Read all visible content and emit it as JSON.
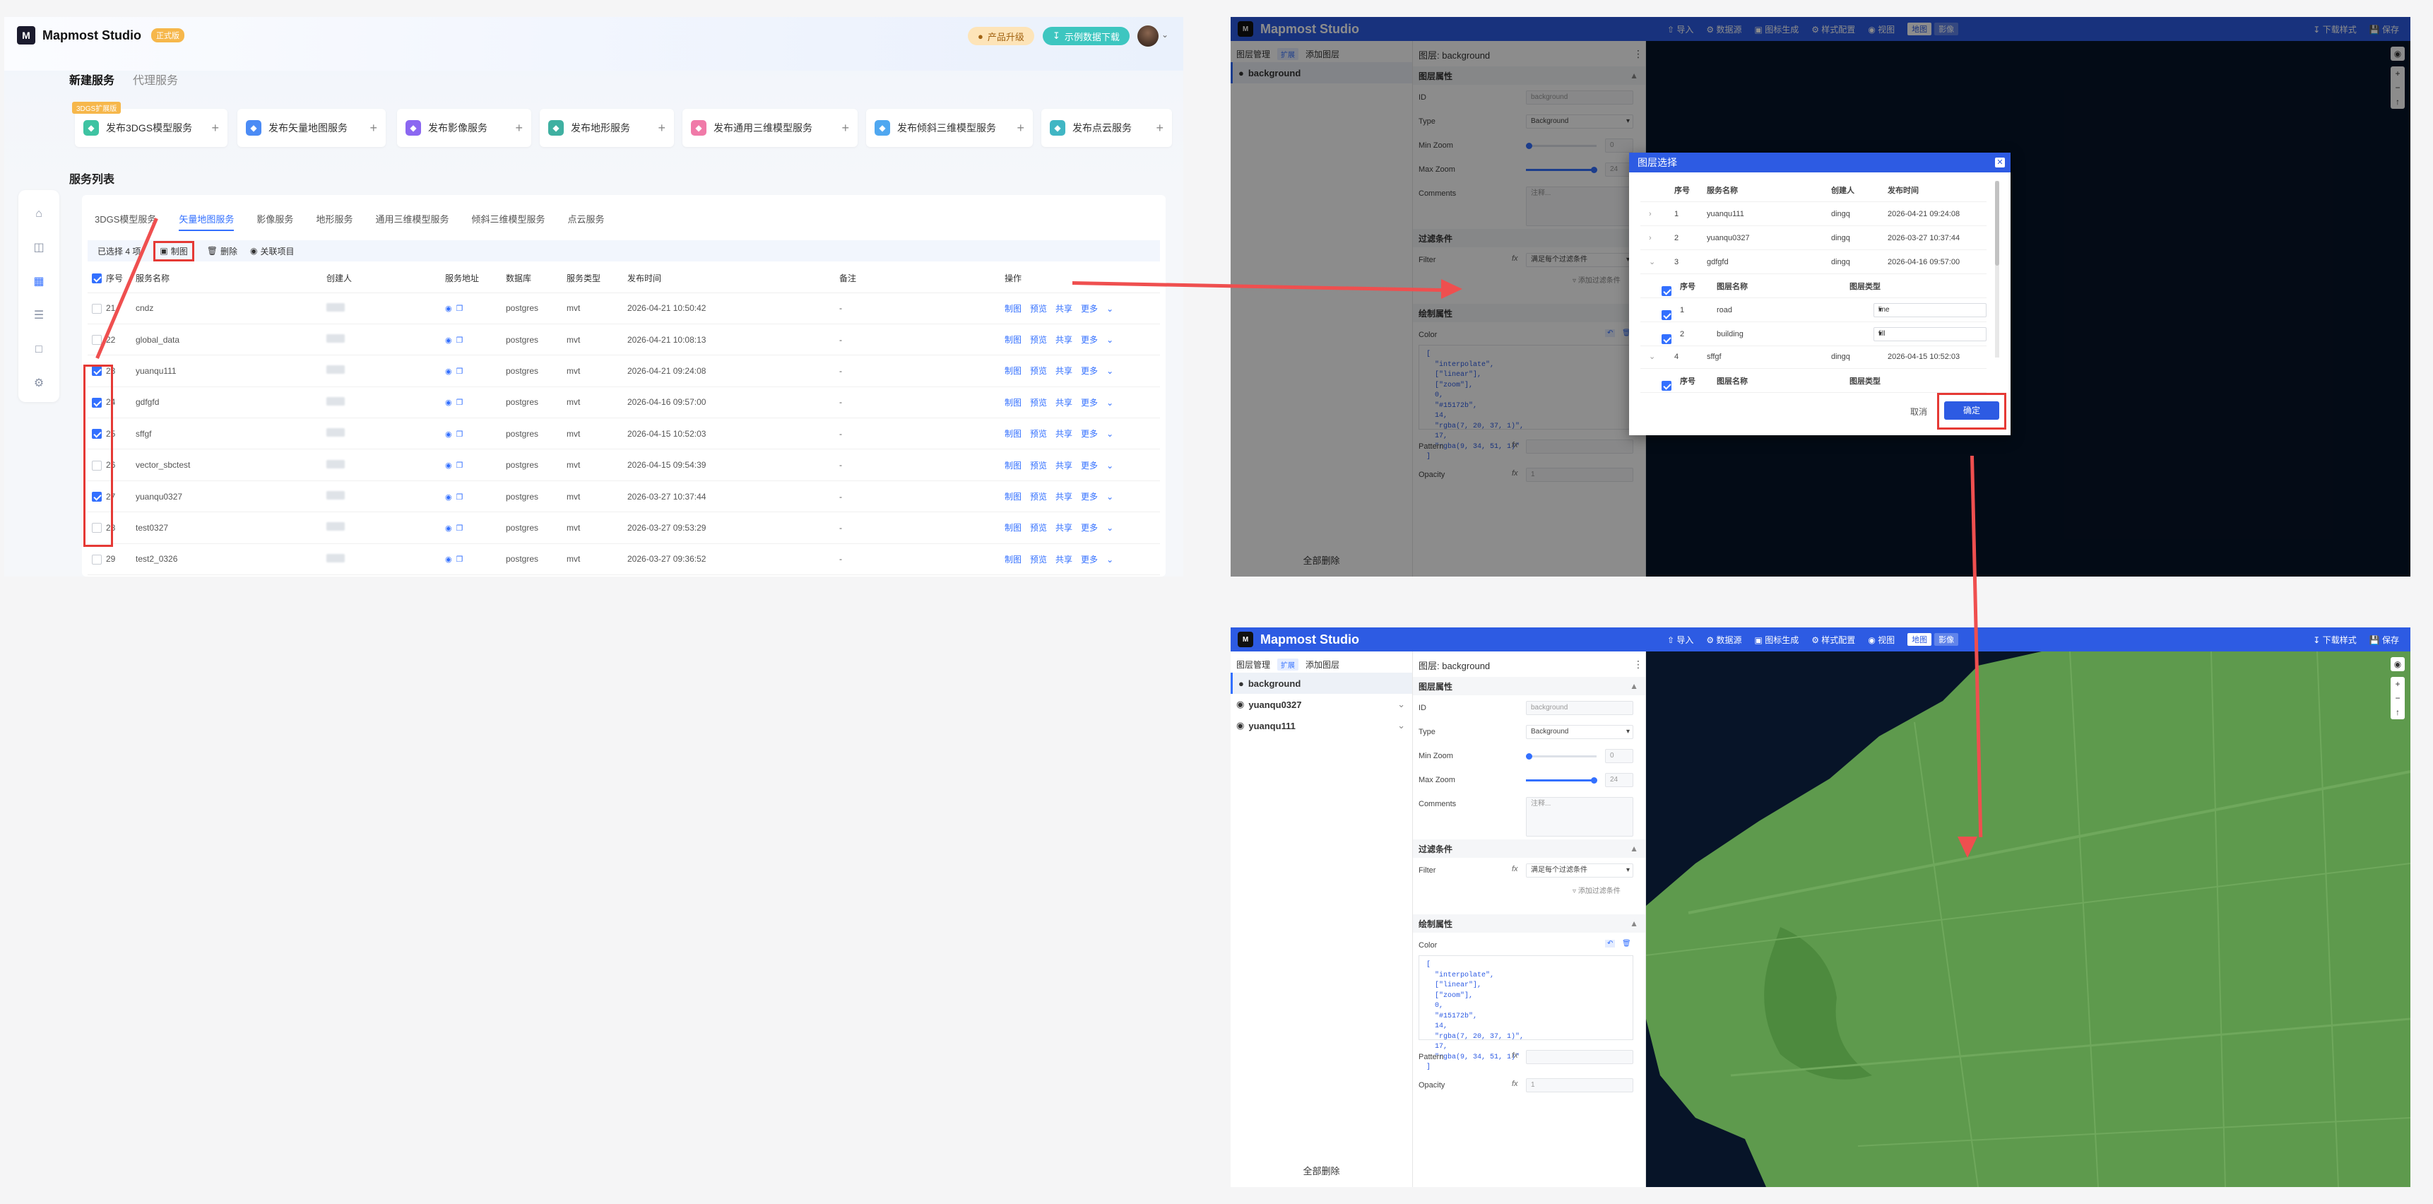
{
  "panelA": {
    "app_name": "Mapmost Studio",
    "edition_badge": "正式版",
    "upgrade_label": "产品升级",
    "sample_download_label": "示例数据下载",
    "top_tabs": [
      "新建服务",
      "代理服务"
    ],
    "beta_tag": "3DGS扩展版",
    "publish_cards": [
      {
        "label": "发布3DGS模型服务",
        "color": "#3ec3a2"
      },
      {
        "label": "发布矢量地图服务",
        "color": "#4b8bf5"
      },
      {
        "label": "发布影像服务",
        "color": "#8b67f1"
      },
      {
        "label": "发布地形服务",
        "color": "#3fb0a1"
      },
      {
        "label": "发布通用三维模型服务",
        "color": "#f07aa8"
      },
      {
        "label": "发布倾斜三维模型服务",
        "color": "#4fa7f0"
      },
      {
        "label": "发布点云服务",
        "color": "#40b6c4"
      }
    ],
    "list_title": "服务列表",
    "service_tabs": [
      "3DGS模型服务",
      "矢量地图服务",
      "影像服务",
      "地形服务",
      "通用三维模型服务",
      "倾斜三维模型服务",
      "点云服务"
    ],
    "selected_text": "已选择 4 项",
    "action_buttons": [
      "制图",
      "删除",
      "关联项目"
    ],
    "columns": [
      "序号",
      "服务名称",
      "创建人",
      "服务地址",
      "数据库",
      "服务类型",
      "发布时间",
      "备注",
      "操作"
    ],
    "row_actions": [
      "制图",
      "预览",
      "共享",
      "更多"
    ],
    "rows": [
      {
        "no": "21",
        "name": "cndz",
        "db": "postgres",
        "type": "mvt",
        "time": "2026-04-21 10:50:42",
        "note": "-",
        "checked": false
      },
      {
        "no": "22",
        "name": "global_data",
        "db": "postgres",
        "type": "mvt",
        "time": "2026-04-21 10:08:13",
        "note": "-",
        "checked": false
      },
      {
        "no": "23",
        "name": "yuanqu111",
        "db": "postgres",
        "type": "mvt",
        "time": "2026-04-21 09:24:08",
        "note": "-",
        "checked": true
      },
      {
        "no": "24",
        "name": "gdfgfd",
        "db": "postgres",
        "type": "mvt",
        "time": "2026-04-16 09:57:00",
        "note": "-",
        "checked": true
      },
      {
        "no": "25",
        "name": "sffgf",
        "db": "postgres",
        "type": "mvt",
        "time": "2026-04-15 10:52:03",
        "note": "-",
        "checked": true
      },
      {
        "no": "26",
        "name": "vector_sbctest",
        "db": "postgres",
        "type": "mvt",
        "time": "2026-04-15 09:54:39",
        "note": "-",
        "checked": false
      },
      {
        "no": "27",
        "name": "yuanqu0327",
        "db": "postgres",
        "type": "mvt",
        "time": "2026-03-27 10:37:44",
        "note": "-",
        "checked": true
      },
      {
        "no": "28",
        "name": "test0327",
        "db": "postgres",
        "type": "mvt",
        "time": "2026-03-27 09:53:29",
        "note": "-",
        "checked": false
      },
      {
        "no": "29",
        "name": "test2_0326",
        "db": "postgres",
        "type": "mvt",
        "time": "2026-03-27 09:36:52",
        "note": "-",
        "checked": false
      }
    ]
  },
  "studio": {
    "app_name": "Mapmost Studio",
    "menu": [
      "导入",
      "数据源",
      "图标生成",
      "样式配置",
      "视图"
    ],
    "view_modes": [
      "地图",
      "影像"
    ],
    "right_menu": [
      "下载样式",
      "保存"
    ],
    "left_tabs": [
      "图层管理",
      "扩展",
      "添加图层"
    ],
    "clear_all": "全部删除",
    "layer_title": "图层: background",
    "sections": {
      "props": "图层属性",
      "filter": "过滤条件",
      "paint": "绘制属性"
    },
    "fields": {
      "id_label": "ID",
      "id_value": "background",
      "type_label": "Type",
      "type_value": "Background",
      "minzoom_label": "Min Zoom",
      "minzoom_value": "0",
      "maxzoom_label": "Max Zoom",
      "maxzoom_value": "24",
      "comments_label": "Comments",
      "comments_placeholder": "注释...",
      "filter_label": "Filter",
      "filter_value": "满足每个过滤条件",
      "add_filter": "添加过滤条件",
      "color_label": "Color",
      "pattern_label": "Pattern",
      "opacity_label": "Opacity",
      "opacity_value": "1"
    },
    "color_code": "[\n  \"interpolate\",\n  [\"linear\"],\n  [\"zoom\"],\n  0,\n  \"#15172b\",\n  14,\n  \"rgba(7, 20, 37, 1)\",\n  17,\n  \"rgba(9, 34, 51, 1)\"\n]"
  },
  "panelB": {
    "layers": [
      "background"
    ],
    "dialog": {
      "title": "图层选择",
      "headers": [
        "序号",
        "服务名称",
        "创建人",
        "发布时间"
      ],
      "services": [
        {
          "no": "1",
          "name": "yuanqu111",
          "creator": "dingq",
          "time": "2026-04-21 09:24:08"
        },
        {
          "no": "2",
          "name": "yuanqu0327",
          "creator": "dingq",
          "time": "2026-03-27 10:37:44"
        },
        {
          "no": "3",
          "name": "gdfgfd",
          "creator": "dingq",
          "time": "2026-04-16 09:57:00"
        },
        {
          "no": "4",
          "name": "sffgf",
          "creator": "dingq",
          "time": "2026-04-15 10:52:03"
        }
      ],
      "sub_headers": [
        "序号",
        "图层名称",
        "图层类型"
      ],
      "sub_layers": [
        {
          "no": "1",
          "name": "road",
          "type": "line"
        },
        {
          "no": "2",
          "name": "building",
          "type": "fill"
        }
      ],
      "cancel_label": "取消",
      "confirm_label": "确定"
    }
  },
  "panelC": {
    "layers": [
      "background",
      "yuanqu0327",
      "yuanqu111"
    ]
  },
  "colors": {
    "studio_header": "#2d5be3",
    "map_dark": "#071428",
    "map_land": "#5e9a4d",
    "annotation_red": "#ef4f4f"
  }
}
